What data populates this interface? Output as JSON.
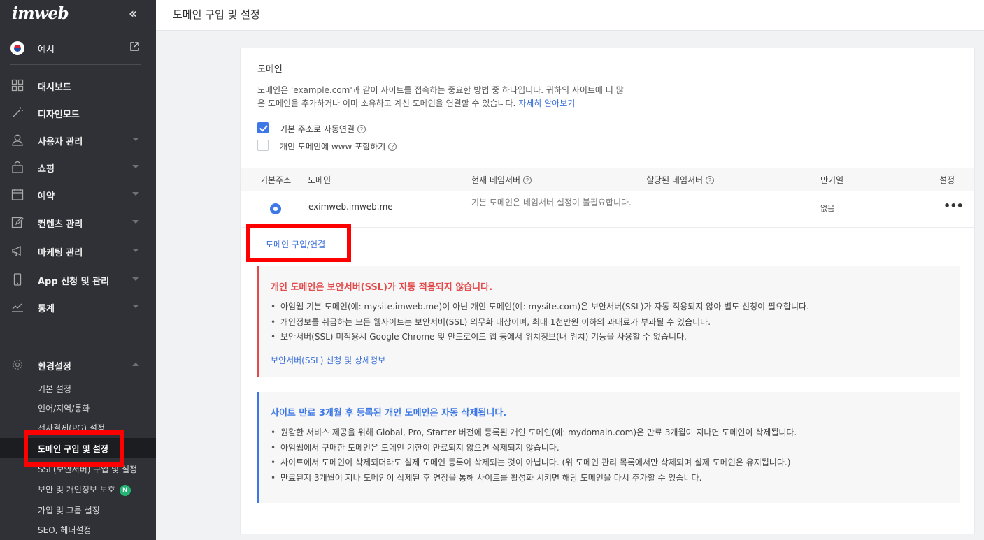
{
  "sidebar": {
    "logo": "imweb",
    "site_name": "예시",
    "items": [
      {
        "label": "대시보드",
        "icon": "dashboard-icon"
      },
      {
        "label": "디자인모드",
        "icon": "magic-wand-icon"
      },
      {
        "label": "사용자 관리",
        "icon": "user-icon"
      },
      {
        "label": "쇼핑",
        "icon": "shopping-bag-icon"
      },
      {
        "label": "예약",
        "icon": "calendar-icon"
      },
      {
        "label": "컨텐츠 관리",
        "icon": "edit-icon"
      },
      {
        "label": "마케팅 관리",
        "icon": "megaphone-icon"
      },
      {
        "label": "App 신청 및 관리",
        "icon": "mobile-icon"
      },
      {
        "label": "통계",
        "icon": "chart-line-icon"
      }
    ],
    "settings": {
      "label": "환경설정",
      "sub_items": [
        "기본 설정",
        "언어/지역/통화",
        "전자결제(PG) 설정",
        "도메인 구입 및 설정",
        "SSL(보안서버) 구입 및 설정",
        "보안 및 개인정보 보호",
        "가입 및 그룹 설정",
        "SEO, 헤더설정"
      ],
      "new_badge": "N"
    }
  },
  "header": {
    "title": "도메인 구입 및 설정"
  },
  "domain": {
    "title": "도메인",
    "desc_line1": "도메인은 'example.com'과 같이 사이트를 접속하는 중요한 방법 중 하나입니다. 귀하의 사이트에 더 많",
    "desc_line2": "은 도메인을 추가하거나 이미 소유하고 계신 도메인을 연결할 수 있습니다.",
    "learn_more": "자세히 알아보기",
    "checkboxes": [
      {
        "label": "기본 주소로 자동연결",
        "checked": true
      },
      {
        "label": "개인 도메인에 www 포함하기",
        "checked": false
      }
    ],
    "table": {
      "headers": [
        "기본주소",
        "도메인",
        "현재 네임서버",
        "할당된 네임서버",
        "만기일",
        "설정"
      ],
      "rows": [
        {
          "domain": "eximweb.imweb.me",
          "current_ns": "기본 도메인은 네임서버 설정이 불필요합니다.",
          "assigned_ns": "",
          "expiry": "없음",
          "more": "•••"
        }
      ]
    },
    "buy_link": "도메인 구입/연결"
  },
  "notice_ssl": {
    "title": "개인 도메인은 보안서버(SSL)가 자동 적용되지 않습니다.",
    "items": [
      "아임웹 기본 도메인(예: mysite.imweb.me)이 아닌 개인 도메인(예: mysite.com)은 보안서버(SSL)가 자동 적용되지 않아 별도 신청이 필요합니다.",
      "개인정보를 취급하는 모든 웹사이트는 보안서버(SSL) 의무화 대상이며, 최대 1천만원 이하의 과태료가 부과될 수 있습니다.",
      "보안서버(SSL) 미적용시 Google Chrome 및 안드로이드 앱 등에서 위치정보(내 위치) 기능을 사용할 수 없습니다."
    ],
    "link": "보안서버(SSL) 신청 및 상세정보"
  },
  "notice_expire": {
    "title": "사이트 만료 3개월 후 등록된 개인 도메인은 자동 삭제됩니다.",
    "items": [
      "원활한 서비스 제공을 위해 Global, Pro, Starter 버전에 등록된 개인 도메인(예: mydomain.com)은 만료 3개월이 지나면 도메인이 삭제됩니다.",
      "아임웹에서 구매한 도메인은 도메인 기한이 만료되지 않으면 삭제되지 않습니다.",
      "사이트에서 도메인이 삭제되더라도 실제 도메인 등록이 삭제되는 것이 아닙니다. (위 도메인 관리 목록에서만 삭제되며 실제 도메인은 유지됩니다.)",
      "만료된지 3개월이 지나 도메인이 삭제된 후 연장을 통해 사이트를 활성화 시키면 해당 도메인을 다시 추가할 수 있습니다."
    ]
  },
  "colors": {
    "sidebar_bg": "#2f3136",
    "accent_blue": "#3d78e6",
    "warning_red": "#e34b4b",
    "highlight_box": "#ff0000"
  }
}
